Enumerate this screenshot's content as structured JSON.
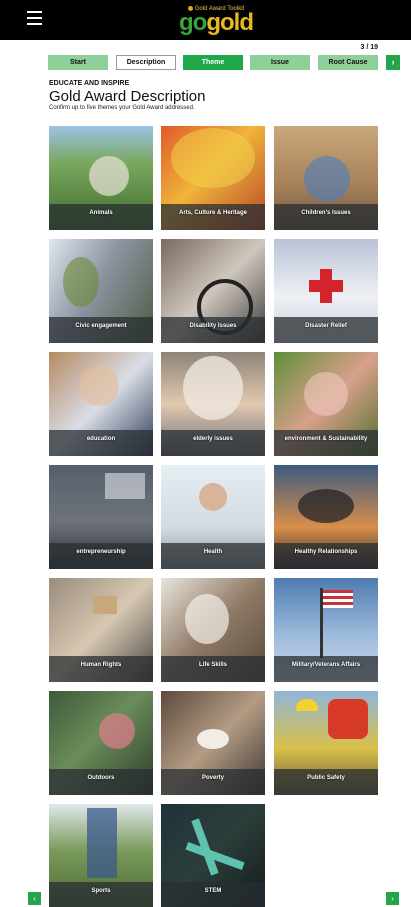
{
  "header": {
    "logo_tagline": "Gold Award Toolkit",
    "logo_go": "go",
    "logo_gold": "gold"
  },
  "progress": {
    "counter": "3 / 19"
  },
  "steps": {
    "start": "Start",
    "description": "Description",
    "theme": "Theme",
    "issue": "Issue",
    "root_cause": "Root Cause",
    "next_icon": "›"
  },
  "intro": {
    "eyebrow": "EDUCATE AND INSPIRE",
    "title": "Gold Award Description",
    "subtitle": "Confirm up to five themes your Gold Award addressed."
  },
  "themes": [
    {
      "label": "Animals"
    },
    {
      "label": "Arts, Culture & Heritage"
    },
    {
      "label": "Children's Issues"
    },
    {
      "label": "Civic engagement"
    },
    {
      "label": "Disability Issues"
    },
    {
      "label": "Disaster Relief"
    },
    {
      "label": "education"
    },
    {
      "label": "elderly issues"
    },
    {
      "label": "environment & Sustainability"
    },
    {
      "label": "entrepreneurship"
    },
    {
      "label": "Health"
    },
    {
      "label": "Healthy Relationships"
    },
    {
      "label": "Human Rights"
    },
    {
      "label": "Life Skills"
    },
    {
      "label": "Military/Veterans Affairs"
    },
    {
      "label": "Outdoors"
    },
    {
      "label": "Poverty"
    },
    {
      "label": "Public Safety"
    },
    {
      "label": "Sports"
    },
    {
      "label": "STEM"
    }
  ],
  "pager": {
    "prev_icon": "‹",
    "next_icon": "›"
  },
  "colors": {
    "brand_green": "#22a649",
    "light_green": "#8fd09a",
    "header_bg": "#000000",
    "logo_gold": "#e8b820"
  }
}
